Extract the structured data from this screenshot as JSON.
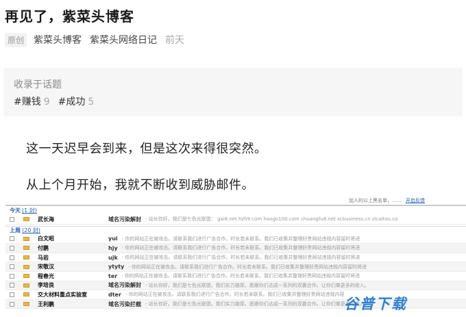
{
  "article": {
    "title": "再见了，紫菜头博客",
    "meta": {
      "badge": "原创",
      "author": "紫菜头博客",
      "column": "紫菜头网络日记",
      "time": "前天"
    },
    "topics": {
      "label": "收录于话题",
      "tags": [
        {
          "name": "#赚钱",
          "count": "9"
        },
        {
          "name": "#成功",
          "count": "5"
        }
      ]
    },
    "paragraphs": [
      "这一天迟早会到来，但是这次来得很突然。",
      "从上个月开始，我就不断收到威胁邮件。"
    ]
  },
  "mail": {
    "top_notice": "加人的以上黑名单，……",
    "top_action": "开启反馈",
    "groups": [
      {
        "label": "今天",
        "count": "(1 封)",
        "rows": [
          {
            "sender": "武长海",
            "subject": "域名污染解封",
            "preview": "- 站长你好。我们是七色光联盟： gai8.net hzh9.com haogo100.com chuangfu8.net scbusiness.cn zicaitou.co"
          }
        ]
      },
      {
        "label": "上周",
        "count": "(20 封)",
        "rows": [
          {
            "sender": "白文昭",
            "subject": "yui",
            "preview": "- 你的网站正在被攻击。请联系我们进行广告合作。时长若未联系。我们已收集并整理好贵网站违规内容留时将进"
          },
          {
            "sender": "付鹏",
            "subject": "hjy",
            "preview": "- 你的网站正在被攻击。请联系我们进行广告合作。时长若未联系。我们已收集并整理好贵网站违规内容留时将进"
          },
          {
            "sender": "马岩",
            "subject": "ujk",
            "preview": "- 你的网站正在被攻击。请联系我们进行广告合作。时长若未联系。我们已收集并整理好贵网站违规内容留时将进"
          },
          {
            "sender": "宋敬汉",
            "subject": "ytyty",
            "preview": "- 你的网站正在被攻击。请联系我们进行广告合作。时长若未联系。我们已收集并整理好贵网站违规内容留时将进"
          },
          {
            "sender": "程春光",
            "subject": "ter",
            "preview": "- 你的网站正在被攻击。请联系我们进行广告合作。时长若未联系。我们已收集并整理好贵网站违规内容留时将进"
          },
          {
            "sender": "李培良",
            "subject": "域名污染解封",
            "preview": "- 站长你好，我们是七色光联盟。我们实力雄厚。愿跟你们达成一系列的双赢合作。让你们做更多的收入。"
          },
          {
            "sender": "交大材料重点实验室",
            "subject": "dter",
            "preview": "- 你的网站正在被攻击。请联系我们进行广告合作。时长若未联系。我们已收集并整理好贵网站违规内容"
          },
          {
            "sender": "王利鹏",
            "subject": "域名污染拦截",
            "preview": "- 站长你好，我们是七色光联盟。我们实力雄厚。愿跟你们达成一系列的双赢合作。让你们做更多的收入。"
          }
        ]
      }
    ]
  },
  "watermark": {
    "text": "谷普下载"
  }
}
